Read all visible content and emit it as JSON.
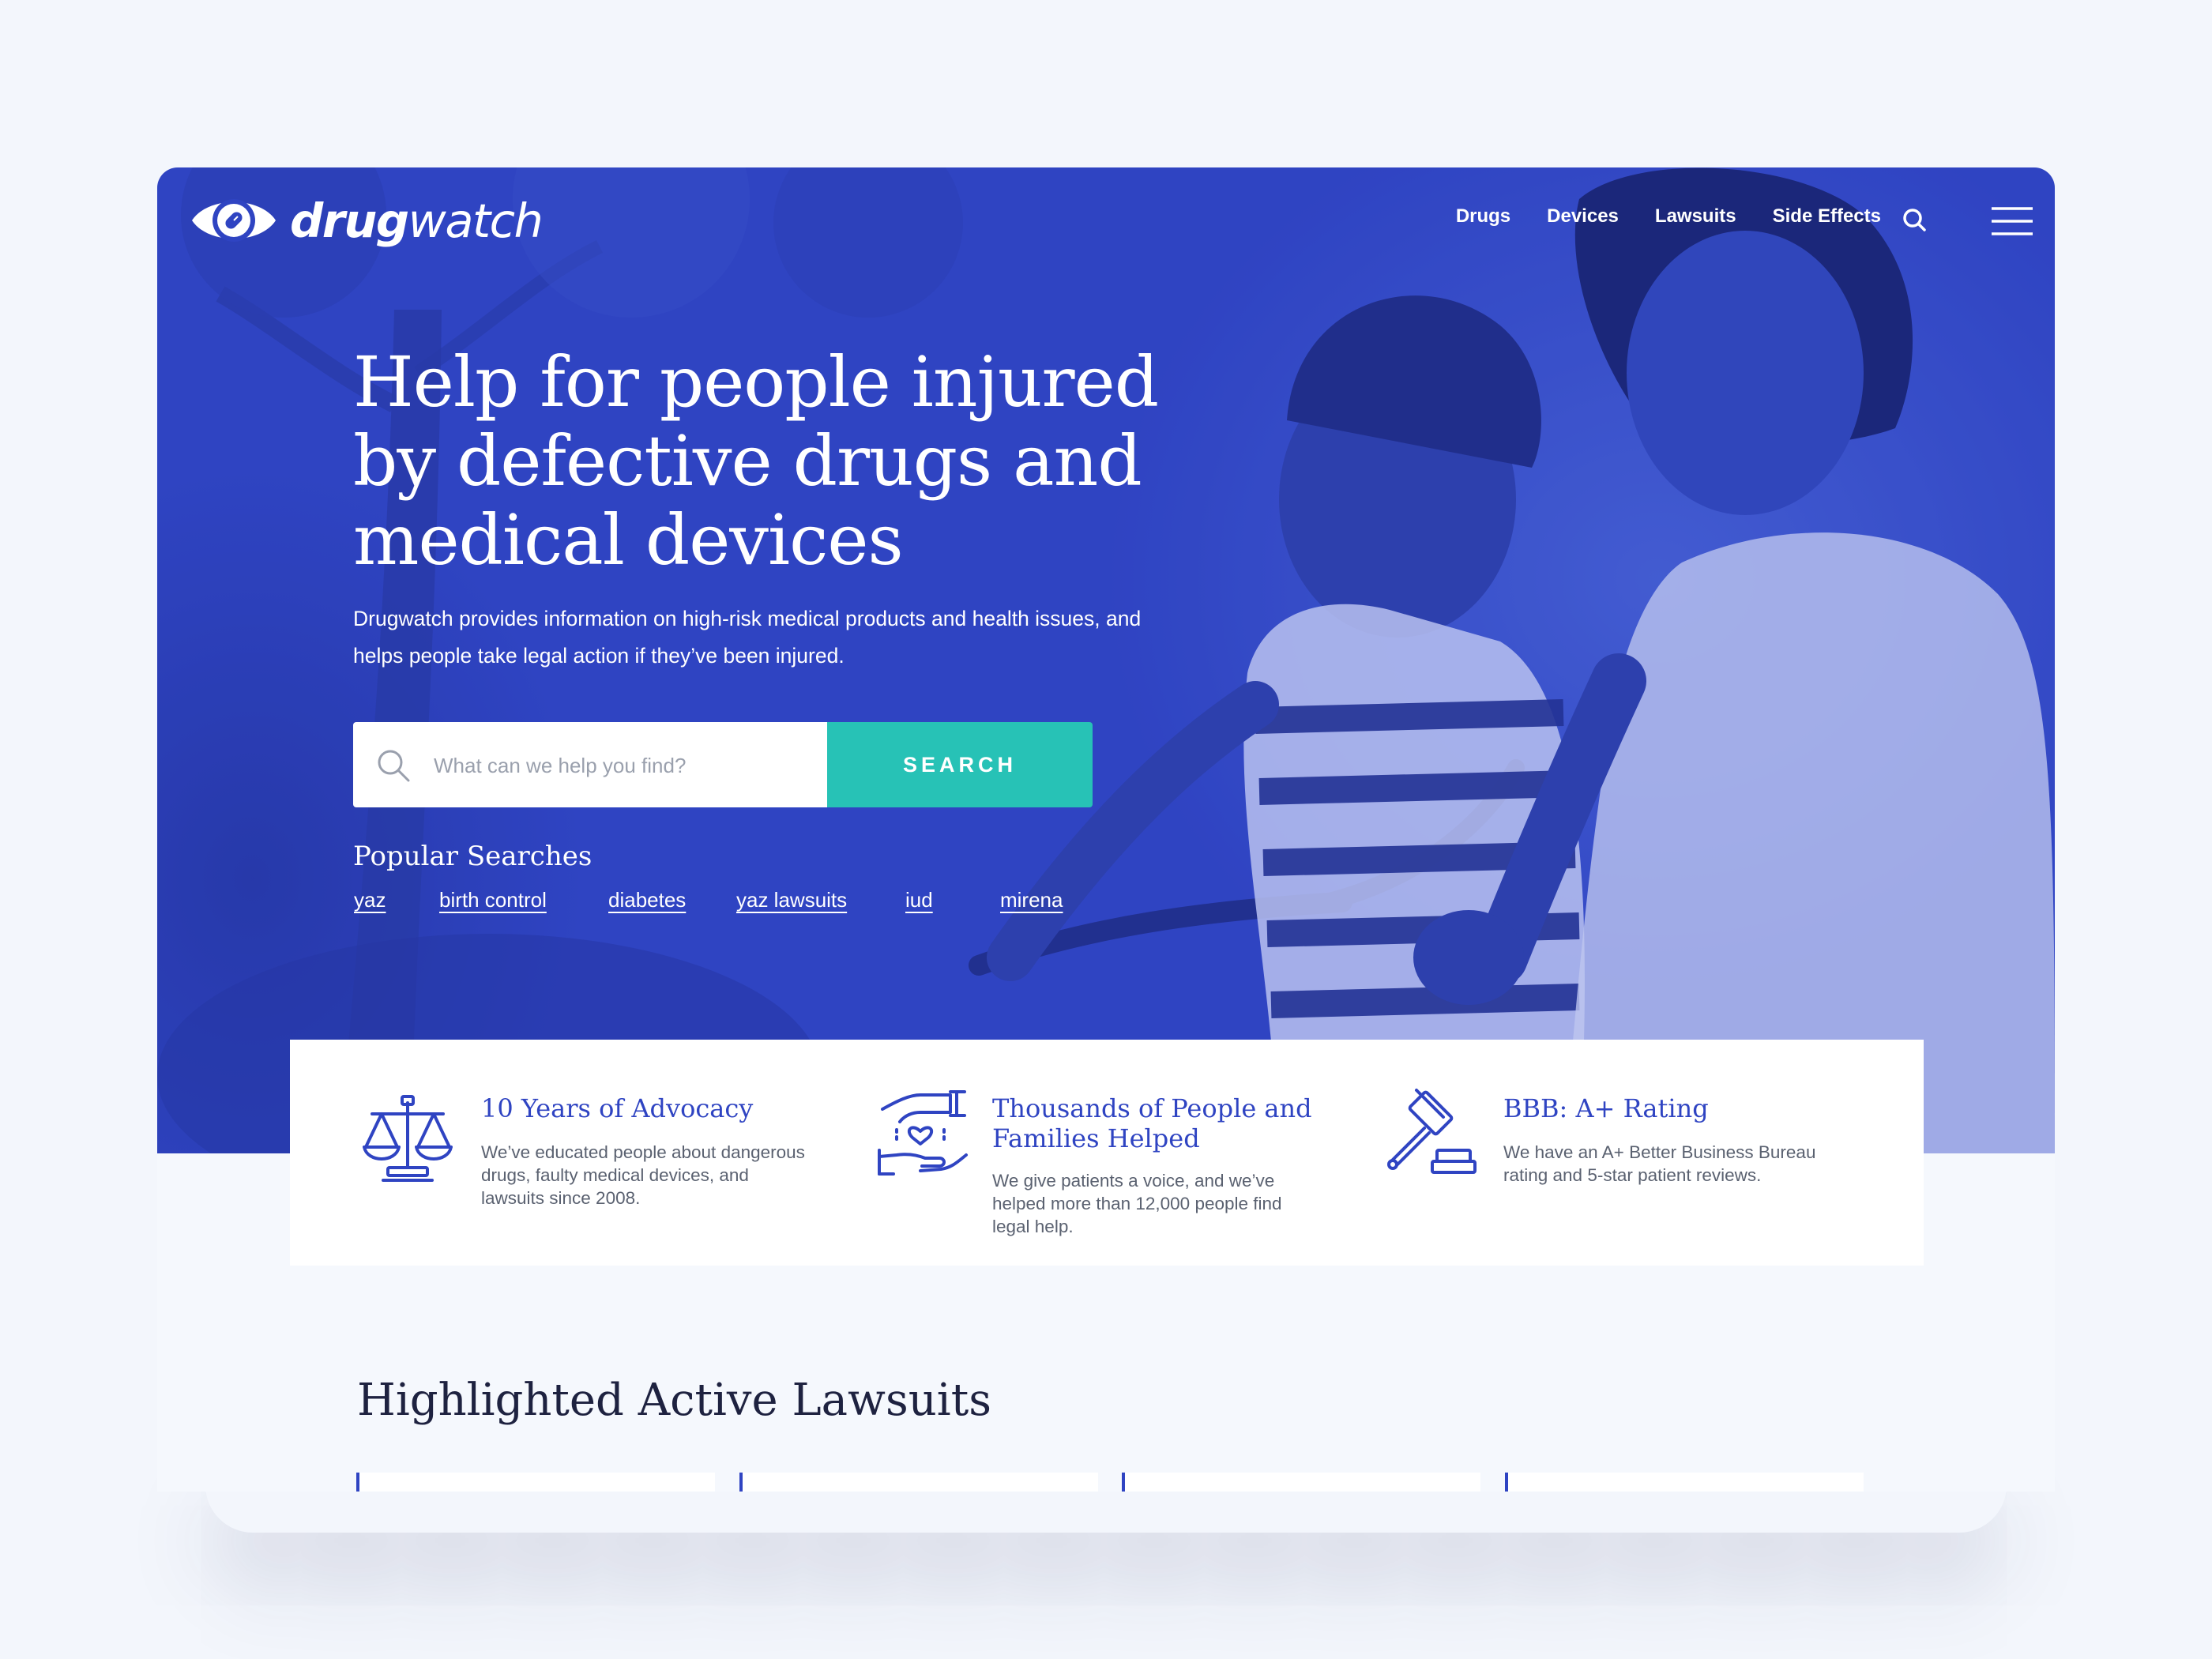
{
  "brand": {
    "logo_bold": "drug",
    "logo_light": "watch",
    "accent": "#2f44c2",
    "button_color": "#27c2b6"
  },
  "nav": {
    "links": [
      "Drugs",
      "Devices",
      "Lawsuits",
      "Side Effects"
    ],
    "icons": [
      "search-icon",
      "hamburger-menu-icon"
    ]
  },
  "hero": {
    "headline": "Help for people injured by defective drugs and medical devices",
    "lede": "Drugwatch provides information on high-risk medical products and health issues, and helps people take legal action if they’ve been injured.",
    "search": {
      "placeholder": "What can we help you find?",
      "button_label": "SEARCH"
    },
    "popular_title": "Popular Searches",
    "popular_links": [
      "yaz",
      "birth control",
      "diabetes",
      "yaz lawsuits",
      "iud",
      "mirena"
    ]
  },
  "stats": [
    {
      "icon": "scales-of-justice-icon",
      "title": "10 Years of Advocacy",
      "description": "We’ve educated people about dangerous drugs, faulty medical devices, and lawsuits since 2008."
    },
    {
      "icon": "helping-hands-heart-icon",
      "title": "Thousands of People and Families Helped",
      "description": "We give patients a voice, and we’ve helped more than 12,000 people find legal help."
    },
    {
      "icon": "gavel-icon",
      "title": "BBB: A+ Rating",
      "description": "We have an A+ Better Business Bureau rating and 5-star patient reviews."
    }
  ],
  "lawsuits": {
    "title": "Highlighted Active Lawsuits"
  }
}
